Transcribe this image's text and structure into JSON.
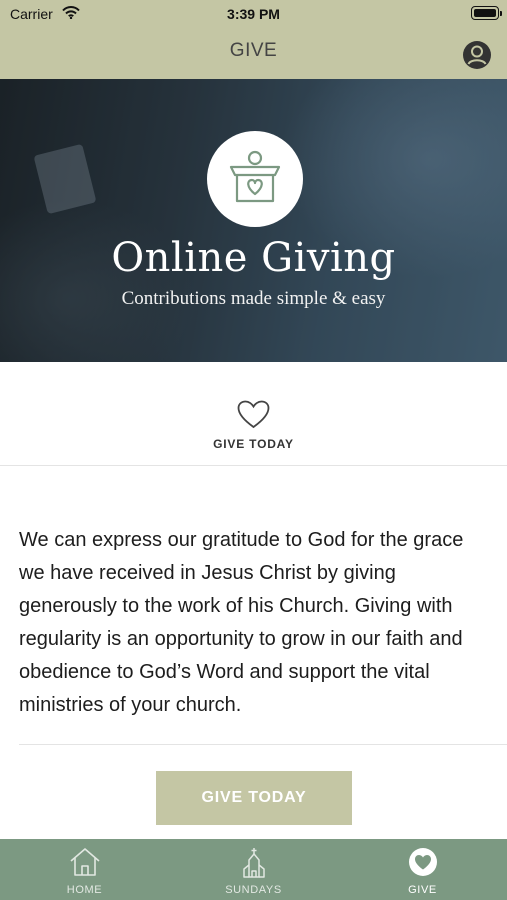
{
  "status_bar": {
    "carrier": "Carrier",
    "time": "3:39 PM"
  },
  "nav": {
    "title": "GIVE"
  },
  "hero": {
    "title": "Online Giving",
    "subtitle": "Contributions made simple & easy"
  },
  "give_strip": {
    "label": "GIVE TODAY"
  },
  "body": {
    "text": "We can express our gratitude to God for the grace we have received in Jesus Christ by giving generously to the work of his Church. Giving with regularity is an opportunity to grow in our faith and obedience to God’s Word and support the vital ministries of your church."
  },
  "cta": {
    "label": "GIVE TODAY"
  },
  "tabs": [
    {
      "label": "HOME",
      "icon": "house-icon"
    },
    {
      "label": "SUNDAYS",
      "icon": "church-icon"
    },
    {
      "label": "GIVE",
      "icon": "heart-icon"
    }
  ],
  "colors": {
    "nav_bg": "#c4c6a4",
    "tab_bg": "#7c9982",
    "icon_green": "#7c9982"
  }
}
